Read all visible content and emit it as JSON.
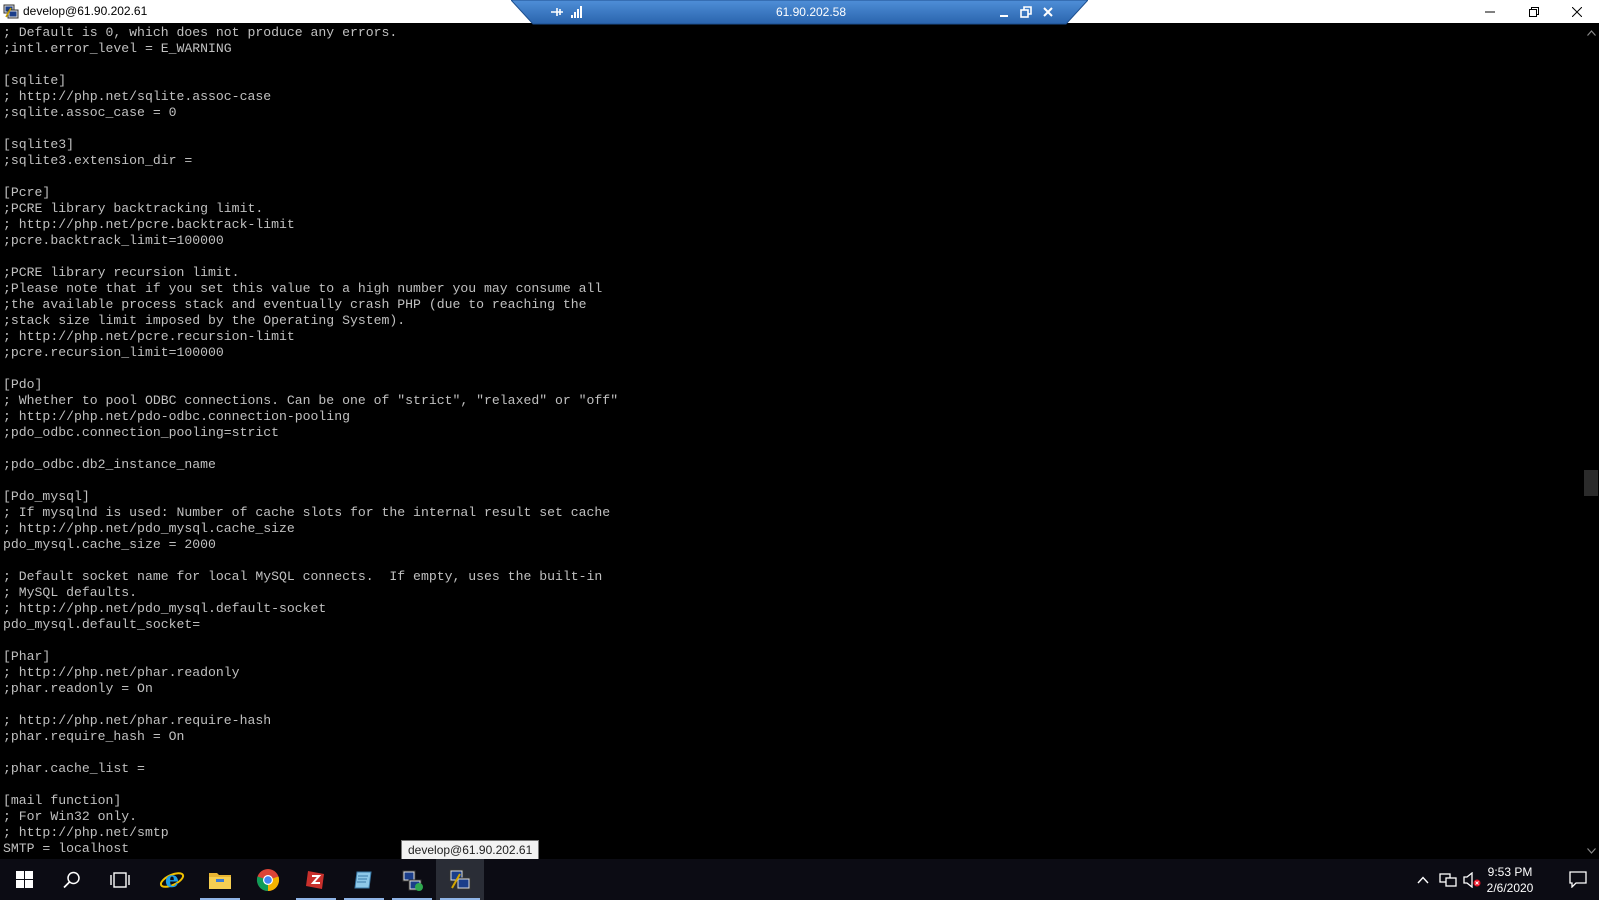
{
  "window": {
    "title": "develop@61.90.202.61",
    "minimize_icon": "minimize-icon",
    "restore_icon": "restore-icon",
    "close_icon": "close-icon"
  },
  "rdp_bar": {
    "host": "61.90.202.58",
    "pin_icon": "pin-icon",
    "signal_icon": "connection-signal-icon"
  },
  "terminal": {
    "lines": [
      "; Default is 0, which does not produce any errors.",
      ";intl.error_level = E_WARNING",
      "",
      "[sqlite]",
      "; http://php.net/sqlite.assoc-case",
      ";sqlite.assoc_case = 0",
      "",
      "[sqlite3]",
      ";sqlite3.extension_dir =",
      "",
      "[Pcre]",
      ";PCRE library backtracking limit.",
      "; http://php.net/pcre.backtrack-limit",
      ";pcre.backtrack_limit=100000",
      "",
      ";PCRE library recursion limit.",
      ";Please note that if you set this value to a high number you may consume all",
      ";the available process stack and eventually crash PHP (due to reaching the",
      ";stack size limit imposed by the Operating System).",
      "; http://php.net/pcre.recursion-limit",
      ";pcre.recursion_limit=100000",
      "",
      "[Pdo]",
      "; Whether to pool ODBC connections. Can be one of \"strict\", \"relaxed\" or \"off\"",
      "; http://php.net/pdo-odbc.connection-pooling",
      ";pdo_odbc.connection_pooling=strict",
      "",
      ";pdo_odbc.db2_instance_name",
      "",
      "[Pdo_mysql]",
      "; If mysqlnd is used: Number of cache slots for the internal result set cache",
      "; http://php.net/pdo_mysql.cache_size",
      "pdo_mysql.cache_size = 2000",
      "",
      "; Default socket name for local MySQL connects.  If empty, uses the built-in",
      "; MySQL defaults.",
      "; http://php.net/pdo_mysql.default-socket",
      "pdo_mysql.default_socket=",
      "",
      "[Phar]",
      "; http://php.net/phar.readonly",
      ";phar.readonly = On",
      "",
      "; http://php.net/phar.require-hash",
      ";phar.require_hash = On",
      "",
      ";phar.cache_list =",
      "",
      "[mail function]",
      "; For Win32 only.",
      "; http://php.net/smtp",
      "SMTP = localhost"
    ]
  },
  "taskbar": {
    "buttons": [
      {
        "name": "start-button",
        "icon": "windows-logo-icon"
      },
      {
        "name": "search-button",
        "icon": "search-icon"
      },
      {
        "name": "task-view-button",
        "icon": "task-view-icon"
      },
      {
        "name": "internet-explorer-button",
        "icon": "internet-explorer-icon"
      },
      {
        "name": "file-explorer-button",
        "icon": "folder-icon"
      },
      {
        "name": "chrome-button",
        "icon": "chrome-icon"
      },
      {
        "name": "filezilla-button",
        "icon": "filezilla-icon"
      },
      {
        "name": "notepad-button",
        "icon": "notepad-icon"
      },
      {
        "name": "network-tool-button",
        "icon": "network-tool-icon"
      },
      {
        "name": "putty-button",
        "icon": "putty-icon"
      }
    ],
    "tooltip": "develop@61.90.202.61",
    "tray": {
      "chevron_icon": "chevron-up-icon",
      "network_icon": "network-icon",
      "volume_icon": "volume-muted-icon",
      "notification_icon": "action-center-icon"
    },
    "clock": {
      "time": "9:53 PM",
      "date": "2/6/2020"
    }
  },
  "colors": {
    "terminal_bg": "#000000",
    "terminal_fg": "#c0c0c0",
    "rdp_bar": "#2f6eb8",
    "taskbar": "#0c0c14",
    "accent": "#8fb4e6"
  }
}
